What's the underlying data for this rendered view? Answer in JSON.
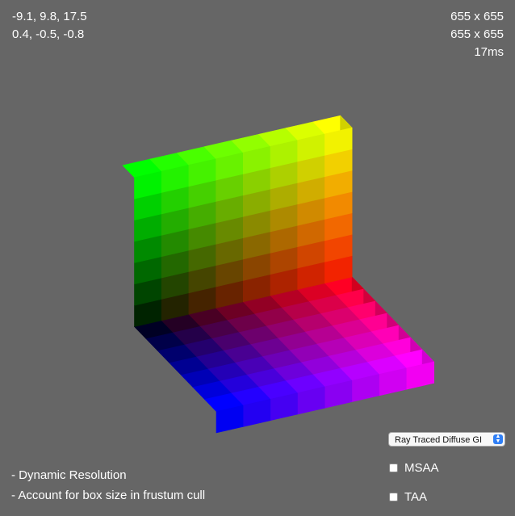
{
  "hud": {
    "camera_position": "-9.1, 9.8, 17.5",
    "camera_direction": "0.4, -0.5, -0.8",
    "render_size": "655 x 655",
    "output_size": "655 x 655",
    "frame_time": "17ms"
  },
  "notes": [
    "- Dynamic Resolution",
    "- Account for box size in frustum cull"
  ],
  "render_mode": {
    "selected": "Ray Traced Diffuse GI"
  },
  "options": {
    "msaa": {
      "label": "MSAA",
      "checked": false
    },
    "taa": {
      "label": "TAA",
      "checked": false
    }
  }
}
